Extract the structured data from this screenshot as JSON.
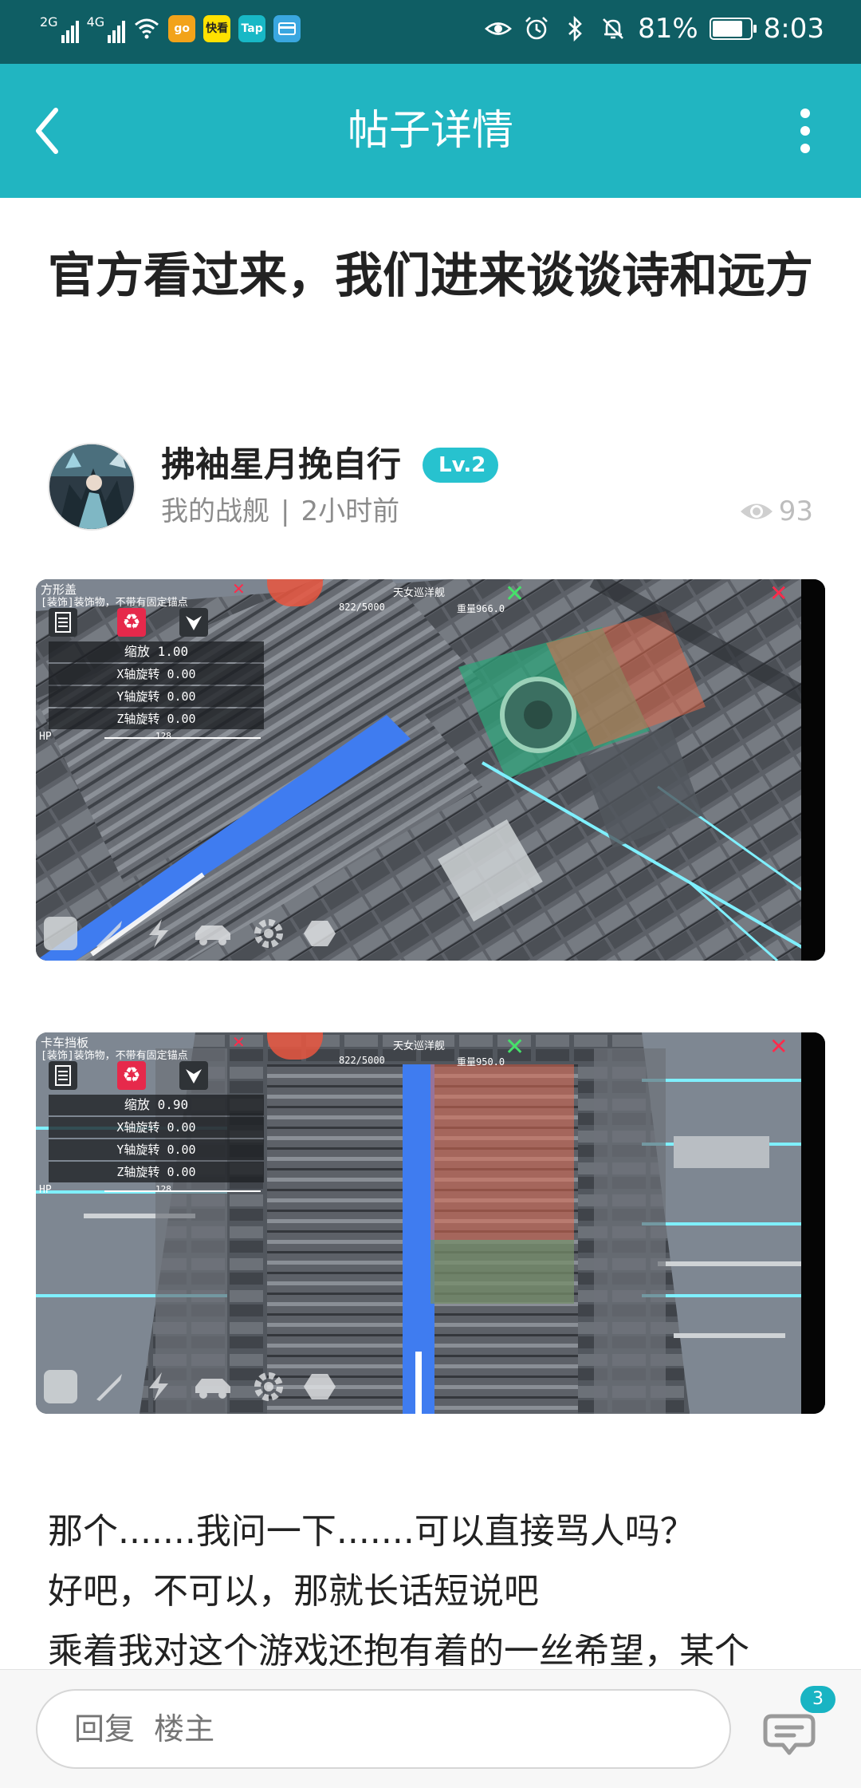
{
  "status_bar": {
    "signal_1": "2G",
    "signal_2": "4G",
    "app_icons": [
      "go",
      "快看",
      "Tap",
      ""
    ],
    "battery": "81%",
    "battery_level": 0.81,
    "time": "8:03"
  },
  "app_bar": {
    "title": "帖子详情"
  },
  "post": {
    "title": "官方看过来，我们进来谈谈诗和远方",
    "author": {
      "name": "拂袖星月挽自行",
      "level": "Lv.2",
      "section": "我的战舰",
      "separator": "|",
      "time": "2小时前",
      "views": "93"
    },
    "screenshots": [
      {
        "part_name": "方形盖",
        "part_desc": "[装饰]装饰物，不带有固定锚点",
        "ship_name": "天女巡洋舰",
        "hp_stat": "822/5000",
        "weight": "重量966.0",
        "rows": [
          {
            "label": "缩放",
            "value": "1.00"
          },
          {
            "label": "X轴旋转",
            "value": "0.00"
          },
          {
            "label": "Y轴旋转",
            "value": "0.00"
          },
          {
            "label": "Z轴旋转",
            "value": "0.00"
          }
        ],
        "hp_label": "HP",
        "hp_value": "128"
      },
      {
        "part_name": "卡车挡板",
        "part_desc": "[装饰]装饰物，不带有固定锚点",
        "ship_name": "天女巡洋舰",
        "hp_stat": "822/5000",
        "weight": "重量950.0",
        "rows": [
          {
            "label": "缩放",
            "value": "0.90"
          },
          {
            "label": "X轴旋转",
            "value": "0.00"
          },
          {
            "label": "Y轴旋转",
            "value": "0.00"
          },
          {
            "label": "Z轴旋转",
            "value": "0.00"
          }
        ],
        "hp_label": "HP",
        "hp_value": "128"
      }
    ],
    "body": [
      "那个.......我问一下.......可以直接骂人吗？",
      "好吧，不可以，那就长话短说吧",
      "乘着我对这个游戏还抱有着的一丝希望，某个"
    ]
  },
  "bottom_bar": {
    "reply_placeholder": "回复  楼主",
    "comment_count": "3"
  },
  "colors": {
    "status_bar": "#0f5e64",
    "app_bar": "#21b5c1",
    "badge": "#27c2cf"
  }
}
